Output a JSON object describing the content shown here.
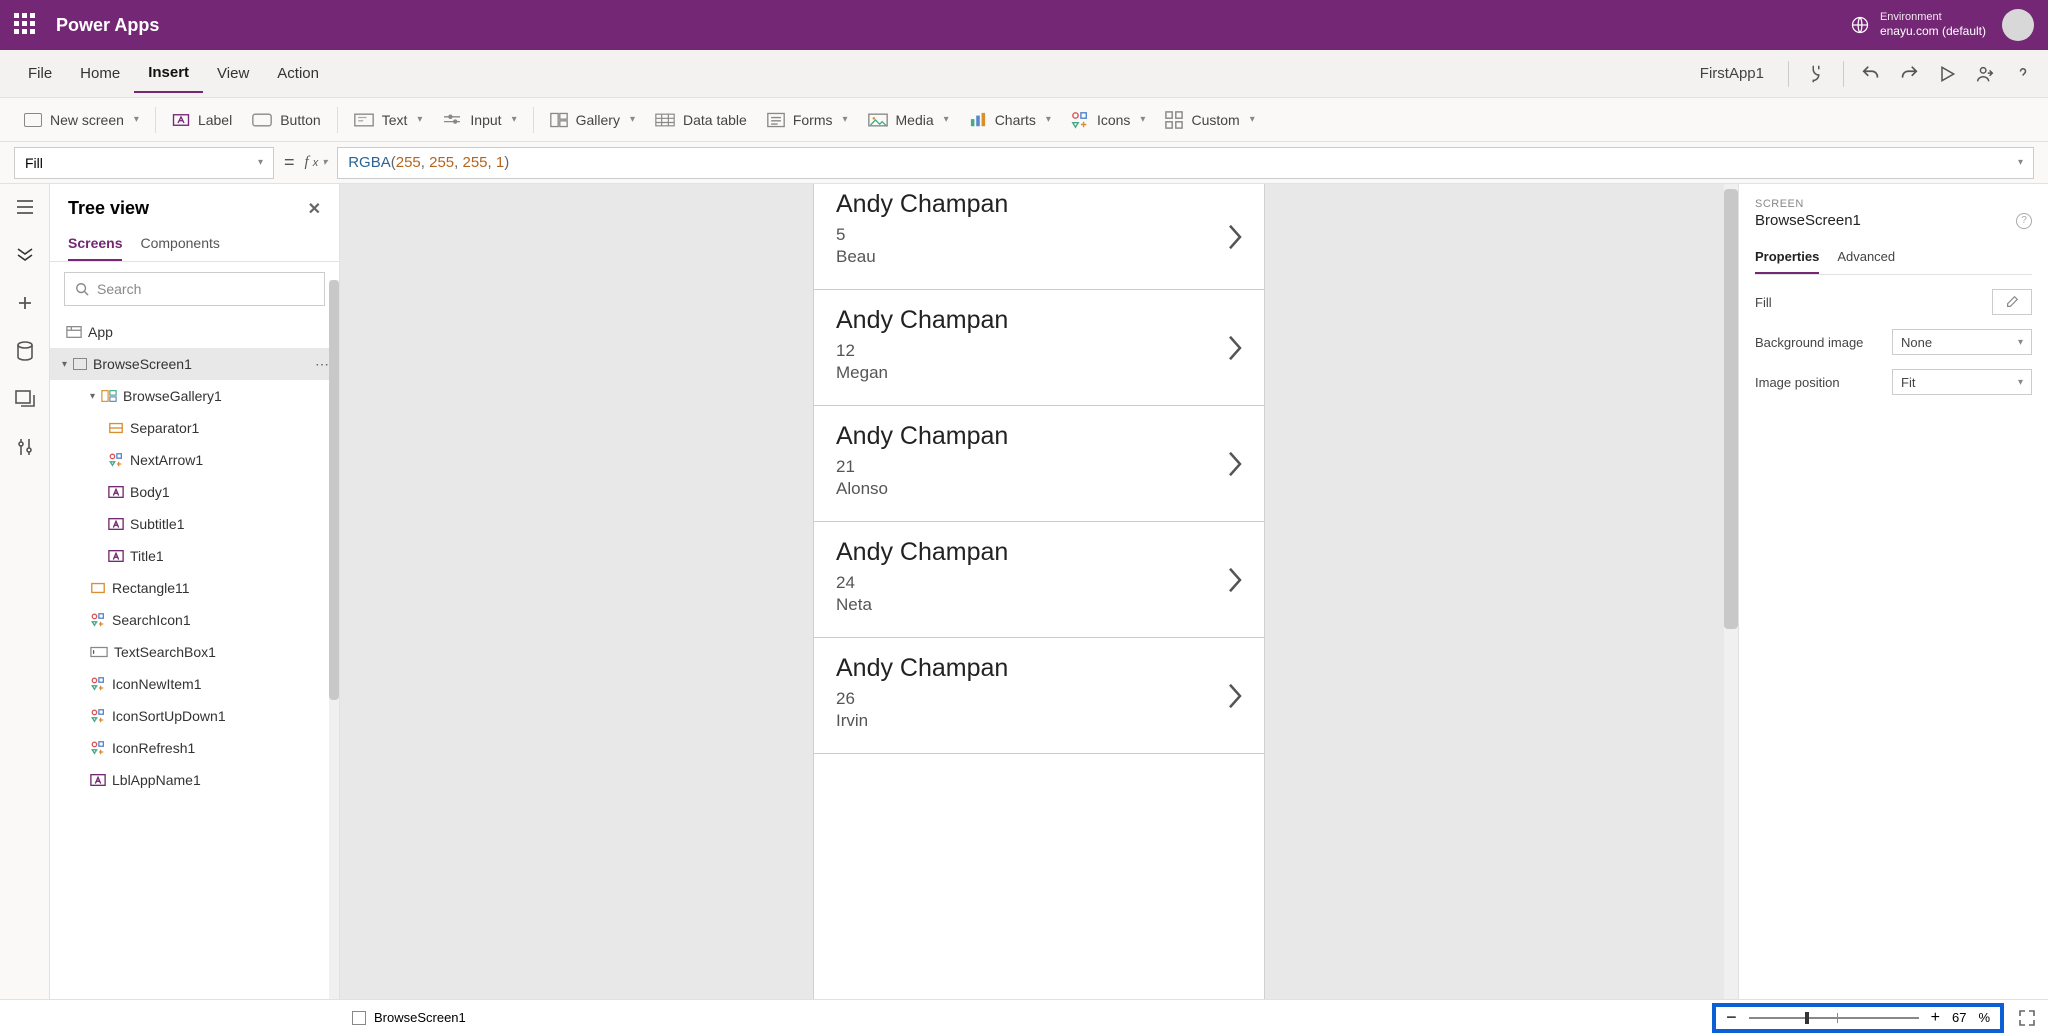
{
  "titlebar": {
    "app": "Power Apps",
    "env_label": "Environment",
    "env_value": "enayu.com (default)"
  },
  "menu": {
    "items": [
      "File",
      "Home",
      "Insert",
      "View",
      "Action"
    ],
    "active": "Insert",
    "appname": "FirstApp1"
  },
  "ribbon": {
    "new_screen": "New screen",
    "label": "Label",
    "button": "Button",
    "text": "Text",
    "input": "Input",
    "gallery": "Gallery",
    "data_table": "Data table",
    "forms": "Forms",
    "media": "Media",
    "charts": "Charts",
    "icons": "Icons",
    "custom": "Custom"
  },
  "formulabar": {
    "property": "Fill",
    "formula_html": "<span class='tok-fn'>RGBA</span><span class='tok-p'>(</span><span class='tok-n'>255</span><span class='tok-p'>, </span><span class='tok-n'>255</span><span class='tok-p'>, </span><span class='tok-n'>255</span><span class='tok-p'>, </span><span class='tok-n'>1</span><span class='tok-p'>)</span>"
  },
  "tree": {
    "title": "Tree view",
    "tabs": {
      "screens": "Screens",
      "components": "Components"
    },
    "search_placeholder": "Search",
    "app_label": "App",
    "selected": "BrowseScreen1",
    "items": [
      {
        "label": "BrowseGallery1",
        "indent": 2
      },
      {
        "label": "Separator1",
        "indent": 3
      },
      {
        "label": "NextArrow1",
        "indent": 3
      },
      {
        "label": "Body1",
        "indent": 3
      },
      {
        "label": "Subtitle1",
        "indent": 3
      },
      {
        "label": "Title1",
        "indent": 3
      },
      {
        "label": "Rectangle11",
        "indent": 2
      },
      {
        "label": "SearchIcon1",
        "indent": 2
      },
      {
        "label": "TextSearchBox1",
        "indent": 2
      },
      {
        "label": "IconNewItem1",
        "indent": 2
      },
      {
        "label": "IconSortUpDown1",
        "indent": 2
      },
      {
        "label": "IconRefresh1",
        "indent": 2
      },
      {
        "label": "LblAppName1",
        "indent": 2
      }
    ]
  },
  "cards": [
    {
      "name": "Andy Champan",
      "num": "5",
      "sub": "Beau"
    },
    {
      "name": "Andy Champan",
      "num": "12",
      "sub": "Megan"
    },
    {
      "name": "Andy Champan",
      "num": "21",
      "sub": "Alonso"
    },
    {
      "name": "Andy Champan",
      "num": "24",
      "sub": "Neta"
    },
    {
      "name": "Andy Champan",
      "num": "26",
      "sub": "Irvin"
    }
  ],
  "props": {
    "type": "SCREEN",
    "name": "BrowseScreen1",
    "tabs": {
      "properties": "Properties",
      "advanced": "Advanced"
    },
    "fill_label": "Fill",
    "bg_label": "Background image",
    "bg_value": "None",
    "pos_label": "Image position",
    "pos_value": "Fit"
  },
  "statusbar": {
    "screen": "BrowseScreen1",
    "zoom": "67",
    "pct": "%"
  }
}
